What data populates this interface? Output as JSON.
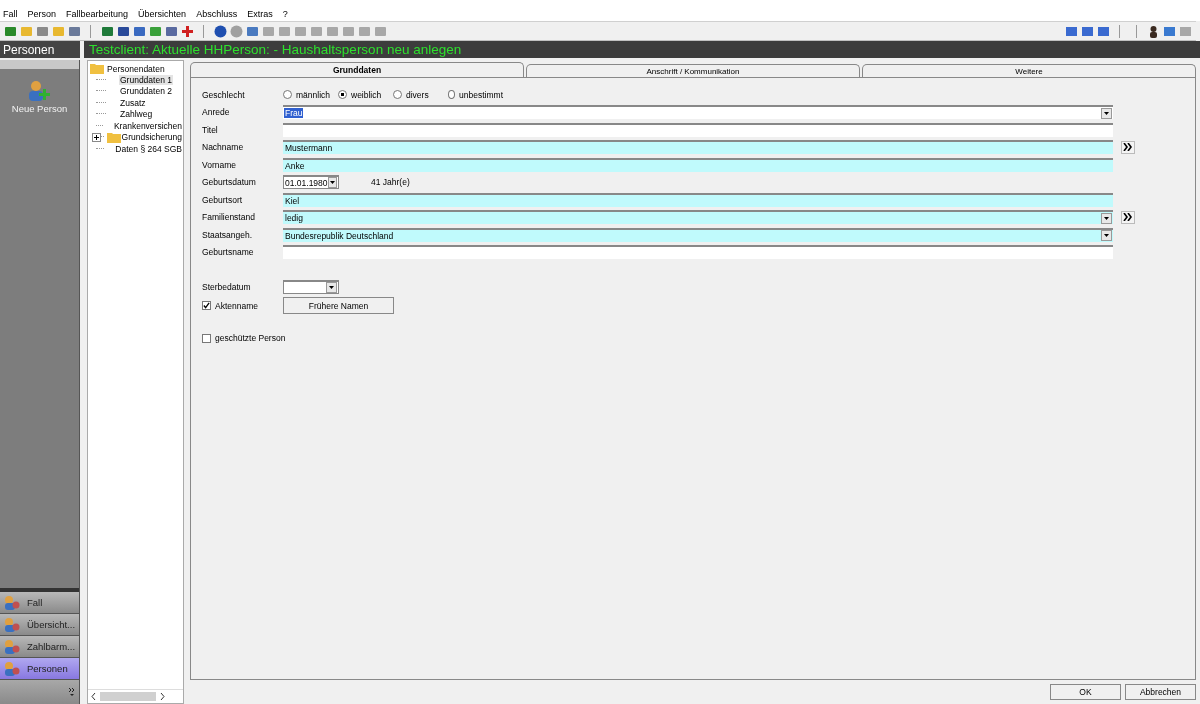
{
  "menu": [
    "Fall",
    "Person",
    "Fallbearbeitung",
    "Übersichten",
    "Abschluss",
    "Extras",
    "?"
  ],
  "header": {
    "section": "Personen",
    "title": "Testclient: Aktuelle HHPerson:  - Haushaltsperson neu anlegen"
  },
  "sidebar": {
    "action": "Neue Person",
    "items": [
      {
        "label": "Fall",
        "selected": false
      },
      {
        "label": "Übersicht...",
        "selected": false
      },
      {
        "label": "Zahlbarm...",
        "selected": false
      },
      {
        "label": "Personen",
        "selected": true
      }
    ]
  },
  "tree": {
    "label": "Personendaten",
    "children": [
      {
        "kind": "page",
        "label": "Grunddaten 1",
        "selected": true
      },
      {
        "kind": "page",
        "label": "Grunddaten 2",
        "selected": false
      },
      {
        "kind": "page",
        "label": "Zusatz",
        "selected": false
      },
      {
        "kind": "page",
        "label": "Zahlweg",
        "selected": false
      },
      {
        "kind": "page",
        "label": "Krankenversichen",
        "selected": false
      },
      {
        "kind": "folder",
        "label": "Grundsicherung",
        "selected": false,
        "expanded": false
      },
      {
        "kind": "page",
        "label": "Daten § 264 SGB",
        "selected": false
      }
    ]
  },
  "tabs": [
    {
      "label": "Grunddaten",
      "selected": true
    },
    {
      "label": "Anschrift / Kommunikation",
      "selected": false
    },
    {
      "label": "Weitere",
      "selected": false
    }
  ],
  "form": {
    "gender": {
      "label": "Geschlecht",
      "options": [
        {
          "label": "männlich",
          "selected": false
        },
        {
          "label": "weiblich",
          "selected": true
        },
        {
          "label": "divers",
          "selected": false
        },
        {
          "label": "unbestimmt",
          "selected": false
        }
      ]
    },
    "fields": [
      {
        "kind": "combo",
        "label": "Anrede",
        "value": "Frau",
        "required": false,
        "value_highlighted": true,
        "more": false
      },
      {
        "kind": "text",
        "label": "Titel",
        "required": false,
        "more": false
      },
      {
        "kind": "text",
        "label": "Nachname",
        "value": "Mustermann",
        "required": true,
        "value_highlighted": false,
        "more": true
      },
      {
        "kind": "text",
        "label": "Vorname",
        "value": "Anke",
        "required": true,
        "value_highlighted": false,
        "more": false
      },
      {
        "kind": "date",
        "label": "Geburtsdatum",
        "value": "01.01.1980",
        "note": "41 Jahr(e)"
      },
      {
        "kind": "text",
        "label": "Geburtsort",
        "value": "Kiel",
        "required": true,
        "value_highlighted": false,
        "more": false
      },
      {
        "kind": "combo",
        "label": "Familienstand",
        "value": "ledig",
        "required": true,
        "value_highlighted": false,
        "more": true
      },
      {
        "kind": "combo",
        "label": "Staatsangeh.",
        "value": "Bundesrepublik Deutschland",
        "required": true,
        "value_highlighted": false,
        "more": false
      },
      {
        "kind": "text",
        "label": "Geburtsname",
        "required": false,
        "more": false
      },
      {
        "kind": "spacer"
      },
      {
        "kind": "date",
        "label": "Sterbedatum"
      },
      {
        "kind": "check_button",
        "label": "Aktenname",
        "checked": true,
        "button": "Frühere Namen"
      },
      {
        "kind": "spacer_small"
      },
      {
        "kind": "check",
        "label": "geschützte Person",
        "checked": false
      }
    ]
  },
  "buttons": [
    "OK",
    "Abbrechen"
  ]
}
